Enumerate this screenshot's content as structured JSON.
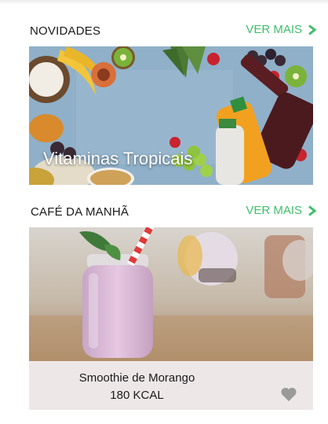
{
  "novidades": {
    "title": "NOVIDADES",
    "ver_mais": "VER MAIS",
    "banner_caption": "Vitaminas Tropicais"
  },
  "cafe": {
    "title": "CAFÉ DA MANHÃ",
    "ver_mais": "VER MAIS",
    "card": {
      "name": "Smoothie de Morango",
      "kcal": "180 KCAL"
    }
  },
  "colors": {
    "accent": "#3fbf6a",
    "card_background": "#eee7e8",
    "heart": "#9a9a9a"
  },
  "icons": {
    "ver_mais": "chevron-right-icon",
    "favorite": "heart-icon"
  }
}
